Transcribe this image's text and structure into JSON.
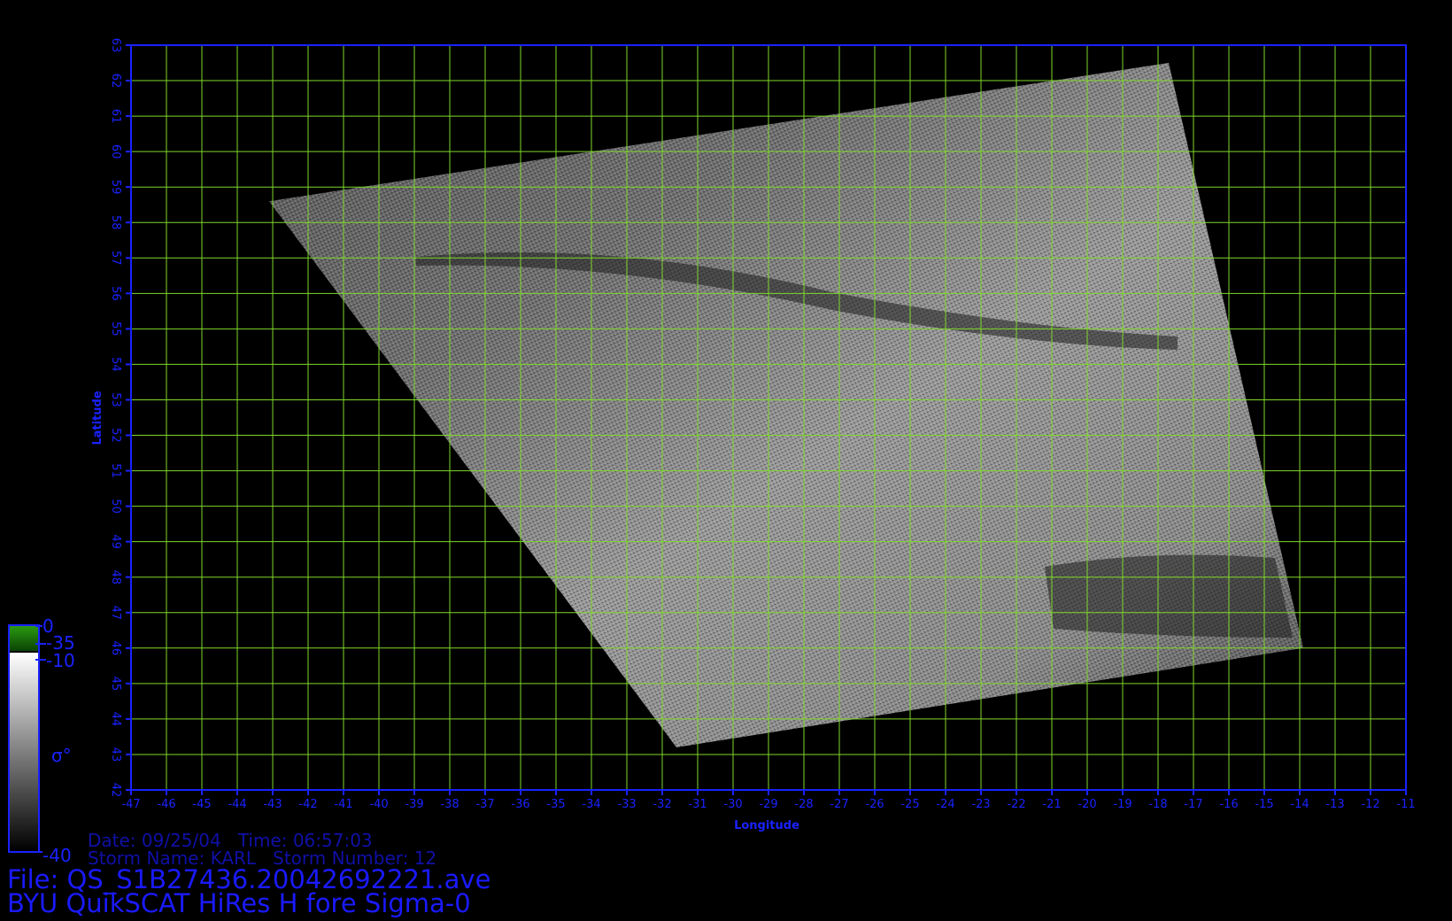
{
  "map": {
    "type": "scatterometer-swath-image",
    "xlabel": "Longitude",
    "ylabel": "Latitude",
    "xlim": [
      -47,
      -11
    ],
    "ylim": [
      42,
      63
    ],
    "x_ticks": [
      "-47",
      "-46",
      "-45",
      "-44",
      "-43",
      "-42",
      "-41",
      "-40",
      "-39",
      "-38",
      "-37",
      "-36",
      "-35",
      "-34",
      "-33",
      "-32",
      "-31",
      "-30",
      "-29",
      "-28",
      "-27",
      "-26",
      "-25",
      "-24",
      "-23",
      "-22",
      "-21",
      "-20",
      "-19",
      "-18",
      "-17",
      "-16",
      "-15",
      "-14",
      "-13",
      "-12",
      "-11"
    ],
    "y_ticks": [
      "42",
      "43",
      "44",
      "45",
      "46",
      "47",
      "48",
      "49",
      "50",
      "51",
      "52",
      "53",
      "54",
      "55",
      "56",
      "57",
      "58",
      "59",
      "60",
      "61",
      "62",
      "63"
    ],
    "grid": true,
    "colors": {
      "background": "#000000",
      "frame": "#1a22ff",
      "grid": "#7fd82a",
      "text": "#1a22ff"
    },
    "swath_corners_lonlat": [
      [
        -43.1,
        58.6
      ],
      [
        -17.7,
        62.5
      ],
      [
        -13.9,
        46.0
      ],
      [
        -31.6,
        43.2
      ]
    ]
  },
  "colorbar": {
    "top_label": "0",
    "label_a": "-35",
    "label_b": "-10",
    "bottom_label": "-40",
    "symbol": "σ°",
    "colors": {
      "green_top": "#2a9a10",
      "green_bottom": "#0b4405",
      "gray_top": "#ffffff",
      "gray_bottom": "#000000",
      "border": "#1a22ff"
    }
  },
  "info": {
    "date_line": "Date: 09/25/04   Time: 06:57:03",
    "storm_line": "Storm Name: KARL   Storm Number: 12",
    "file_line": "File: QS_S1B27436.20042692221.ave",
    "title_line": "BYU QuikSCAT HiRes H fore Sigma-0"
  }
}
